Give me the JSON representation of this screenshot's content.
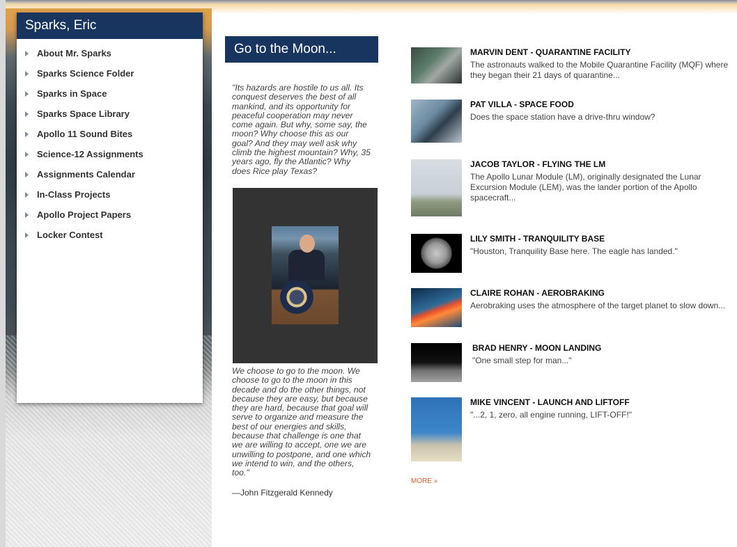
{
  "sidebar": {
    "title": "Sparks, Eric",
    "items": [
      {
        "label": "About Mr. Sparks"
      },
      {
        "label": "Sparks Science Folder"
      },
      {
        "label": "Sparks in Space"
      },
      {
        "label": "Sparks Space Library"
      },
      {
        "label": "Apollo 11 Sound Bites"
      },
      {
        "label": "Science-12 Assignments"
      },
      {
        "label": "Assignments Calendar"
      },
      {
        "label": "In-Class Projects"
      },
      {
        "label": "Apollo Project Papers"
      },
      {
        "label": "Locker Contest"
      }
    ]
  },
  "main": {
    "title": "Go to the Moon...",
    "quote_top": "\"Its hazards are hostile to us all. Its conquest deserves the best of all mankind, and its opportunity for peaceful cooperation may never come again. But why, some say, the moon? Why choose this as our goal? And they may well ask why climb the highest mountain? Why, 35 years ago, fly the Atlantic? Why does Rice play Texas?",
    "quote_bottom": "We choose to go to the moon. We choose to go to the moon in this decade and do the other things, not because they are easy, but because they are hard, because that goal will serve to organize and measure the best of our energies and skills, because that challenge is one that we are willing to accept, one we are unwilling to postpone, and one which we intend to win, and the others, too.\"",
    "attribution": "—John Fitzgerald Kennedy"
  },
  "articles": [
    {
      "title": "MARVIN DENT - QUARANTINE FACILITY",
      "desc": "The astronauts walked to the Mobile Quarantine Facility (MQF) where they began their 21 days of quarantine..."
    },
    {
      "title": "PAT VILLA - SPACE FOOD",
      "desc": "Does the space station have a drive-thru window?"
    },
    {
      "title": "JACOB TAYLOR - FLYING THE LM",
      "desc": "The Apollo Lunar Module (LM), originally designated the Lunar Excursion Module (LEM), was the lander portion of the Apollo spacecraft..."
    },
    {
      "title": "LILY SMITH - TRANQUILITY BASE",
      "desc": "\"Houston, Tranquility Base here. The eagle has landed.\""
    },
    {
      "title": "CLAIRE ROHAN - AEROBRAKING",
      "desc": "Aerobraking uses the atmosphere of the target planet to slow down..."
    },
    {
      "title": "BRAD HENRY - MOON LANDING",
      "desc": "\"One small step for man...\""
    },
    {
      "title": "MIKE VINCENT - LAUNCH AND LIFTOFF",
      "desc": "\"...2, 1, zero, all engine running, LIFT-OFF!\""
    }
  ],
  "more_label": "MORE »"
}
